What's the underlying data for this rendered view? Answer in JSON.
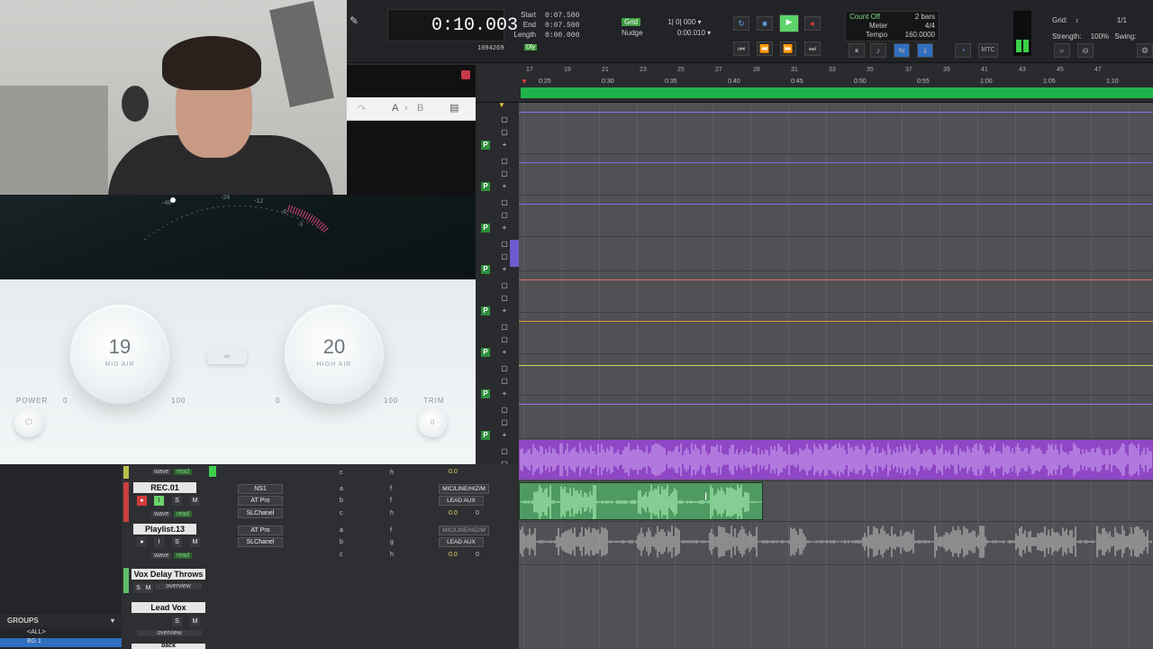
{
  "transport": {
    "counter": "0:10.003",
    "start_label": "Start",
    "end_label": "End",
    "length_label": "Length",
    "start": "0:07.500",
    "end": "0:07.500",
    "length": "0:00.000",
    "samples": "1094269",
    "dly_label": "Dly",
    "grid_label": "Grid",
    "grid_value": "1| 0| 000",
    "nudge_label": "Nudge",
    "nudge_value": "0:00.010",
    "count_off": "Count Off",
    "meter_label": "Meter",
    "tempo_label": "Tempo",
    "count_bars": "2 bars",
    "meter_value": "4/4",
    "tempo_value": "160.0000",
    "mtc": "MTC",
    "grid_right_label": "Grid:",
    "grid_right_value": "1/1",
    "strength_label": "Strength:",
    "strength_value": "100%",
    "swing_label": "Swing:"
  },
  "ruler": {
    "bars": [
      "17",
      "19",
      "21",
      "23",
      "25",
      "27",
      "28",
      "31",
      "33",
      "35",
      "37",
      "39",
      "41",
      "43",
      "45",
      "47"
    ],
    "times": [
      "0:25",
      "0:30",
      "0:35",
      "0:40",
      "0:45",
      "0:50",
      "0:55",
      "1:00",
      "1:05",
      "1:10"
    ]
  },
  "plugin": {
    "ab_a": "A",
    "ab_b": "B",
    "knob1_value": "19",
    "knob1_label": "MID AIR",
    "knob2_value": "20",
    "knob2_label": "HIGH AIR",
    "power_label": "POWER",
    "trim_label": "TRIM",
    "trim_value": "0",
    "k1_min": "0",
    "k1_max": "100",
    "k2_min": "0",
    "k2_max": "100",
    "meter_ticks": [
      "-48",
      "-24",
      "-12",
      "-6",
      "-3"
    ]
  },
  "tracks": [
    {
      "name": "",
      "view": "wave",
      "mode": "read",
      "vol": "0.0",
      "send1": "c",
      "send2": "h"
    },
    {
      "name": "REC.01",
      "view": "wave",
      "mode": "read",
      "inserts": [
        "NS1",
        "AT Pro",
        "SLChanel"
      ],
      "sends": [
        "a",
        "b",
        "c"
      ],
      "sends2": [
        "f",
        "f",
        "h"
      ],
      "io_in": "MIC/LINE/HIZ/M",
      "io_out": "LEAD AUX",
      "vol": "0.0",
      "pan": "0"
    },
    {
      "name": "Playlist.13",
      "view": "wave",
      "mode": "read",
      "inserts": [
        "AT Pro",
        "SLChanel"
      ],
      "sends": [
        "a",
        "b",
        "c"
      ],
      "sends2": [
        "f",
        "g",
        "h"
      ],
      "io_in": "MIC/LINE/HIZ/M",
      "io_out": "LEAD AUX",
      "vol": "0.0",
      "pan": "0"
    },
    {
      "name": "Vox Delay Throws",
      "view": "overview"
    },
    {
      "name": "Lead Vox",
      "view": "overview"
    },
    {
      "name": "back"
    }
  ],
  "groups": {
    "title": "GROUPS",
    "items": [
      "<ALL>",
      "BG 1"
    ]
  },
  "colors": {
    "purple_clip": "#8f47c5",
    "green_clip": "#4f9a63",
    "record": "#d23a3a",
    "accent_green": "#21b34b"
  }
}
